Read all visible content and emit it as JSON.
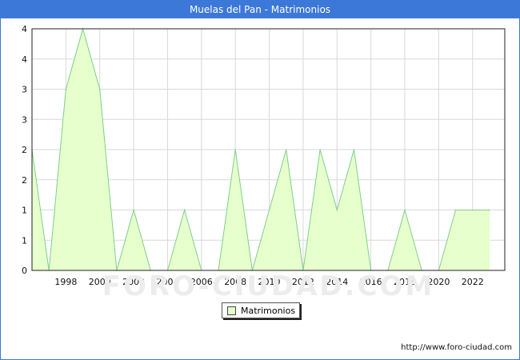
{
  "window": {
    "title": "Muelas del Pan - Matrimonios"
  },
  "footer": {
    "url": "http://www.foro-ciudad.com"
  },
  "watermark": "FORO-CIUDAD.COM",
  "colors": {
    "header": "#3c78d8",
    "fill": "#e6ffcc",
    "line": "#7fcf8b",
    "grid": "#d8d8d8"
  },
  "chart_data": {
    "type": "area",
    "title": "Muelas del Pan - Matrimonios",
    "x": [
      1996,
      1997,
      1998,
      1999,
      2000,
      2001,
      2002,
      2003,
      2004,
      2005,
      2006,
      2007,
      2008,
      2009,
      2010,
      2011,
      2012,
      2013,
      2014,
      2015,
      2016,
      2017,
      2018,
      2019,
      2020,
      2021,
      2022,
      2023
    ],
    "x_ticks": [
      "1998",
      "2000",
      "2002",
      "2004",
      "2006",
      "2008",
      "2010",
      "2012",
      "2014",
      "2016",
      "2018",
      "2020",
      "2022"
    ],
    "y_ticks": [
      "0",
      "1",
      "1",
      "2",
      "2",
      "3",
      "3",
      "4",
      "4"
    ],
    "ylim": [
      0,
      4
    ],
    "series": [
      {
        "name": "Matrimonios",
        "values": [
          2,
          0,
          3,
          4,
          3,
          0,
          1,
          0,
          0,
          1,
          0,
          0,
          2,
          0,
          1,
          2,
          0,
          2,
          1,
          2,
          0,
          0,
          1,
          0,
          0,
          1,
          1,
          1
        ]
      }
    ],
    "legend": "bottom-center",
    "grid": true
  }
}
